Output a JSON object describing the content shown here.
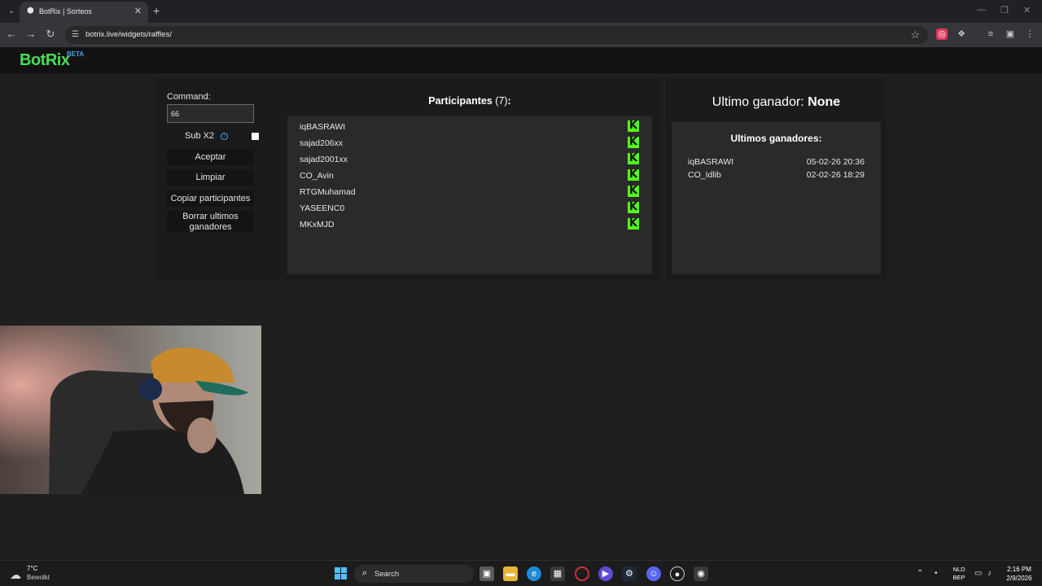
{
  "browser": {
    "tab_title": "BotRix | Sorteos",
    "tab_favicon": "botrix-favicon",
    "url": "botrix.live/widgets/raffles/"
  },
  "site": {
    "logo": "BotRix",
    "beta": "BETA"
  },
  "raffle": {
    "command_label": "Command:",
    "command_value": "66",
    "sub_x2_label": "Sub X2",
    "sub_x2_checked": false,
    "buttons": {
      "accept": "Aceptar",
      "clear": "Limpiar",
      "copy": "Copiar participantes",
      "delete_winners": "Borrar ultimos ganadores"
    }
  },
  "participants": {
    "title": "Participantes",
    "count": "(7)",
    "suffix": ":",
    "items": [
      {
        "name": "iqBASRAWI",
        "platform": "kick"
      },
      {
        "name": "sajad206xx",
        "platform": "kick"
      },
      {
        "name": "sajad2001xx",
        "platform": "kick"
      },
      {
        "name": "CO_Avin",
        "platform": "kick"
      },
      {
        "name": "RTGMuhamad",
        "platform": "kick"
      },
      {
        "name": "YASEENC0",
        "platform": "kick"
      },
      {
        "name": "MKxMJD",
        "platform": "kick"
      }
    ]
  },
  "winners": {
    "last_label": "Ultimo ganador:",
    "last_value": "None",
    "list_title": "Ultimos ganadores:",
    "items": [
      {
        "name": "iqBASRAWI",
        "date": "05-02-26 20:36"
      },
      {
        "name": "CO_Idlib",
        "date": "02-02-26 18:29"
      }
    ]
  },
  "taskbar": {
    "weather_temp": "7°C",
    "weather_desc": "Bewolkt",
    "search_placeholder": "Search",
    "lang_top": "NLD",
    "lang_bottom": "BEP",
    "time": "2:16 PM",
    "date": "2/9/2026"
  },
  "colors": {
    "brand_green": "#4ade57",
    "kick_green": "#53fc18",
    "beta_blue": "#4ea3e8"
  }
}
